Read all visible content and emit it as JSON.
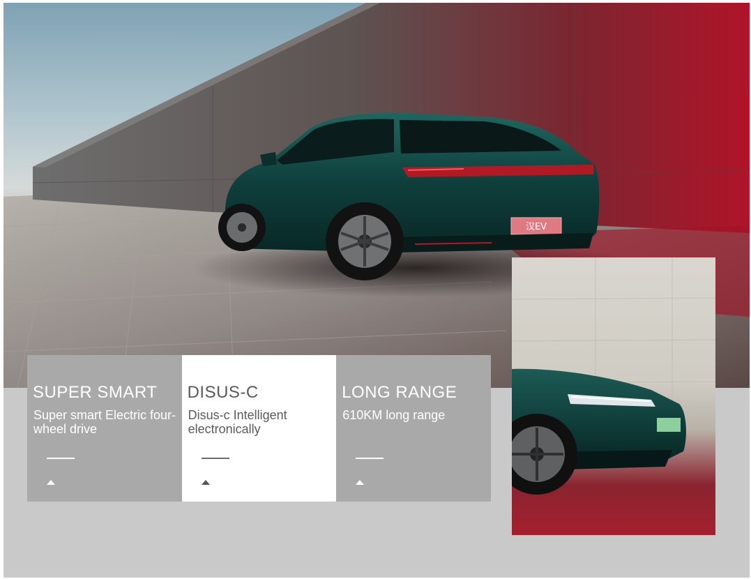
{
  "cards": [
    {
      "title": "SUPER SMART",
      "desc": "Super smart Electric four-wheel drive",
      "active": false
    },
    {
      "title": "DISUS-C",
      "desc": "Disus-c Intelligent electronically",
      "active": true
    },
    {
      "title": "LONG RANGE",
      "desc": "610KM long range",
      "active": false
    }
  ],
  "hero": {
    "plate_text": "汉EV"
  },
  "icons": {
    "card_indicator": "caret-up-icon"
  },
  "colors": {
    "card_bg": "#a9a9a9",
    "card_active_bg": "#ffffff",
    "panel_bg": "#c9c9c9",
    "car_body": "#0f3f3c",
    "accent_red": "#b31428"
  }
}
